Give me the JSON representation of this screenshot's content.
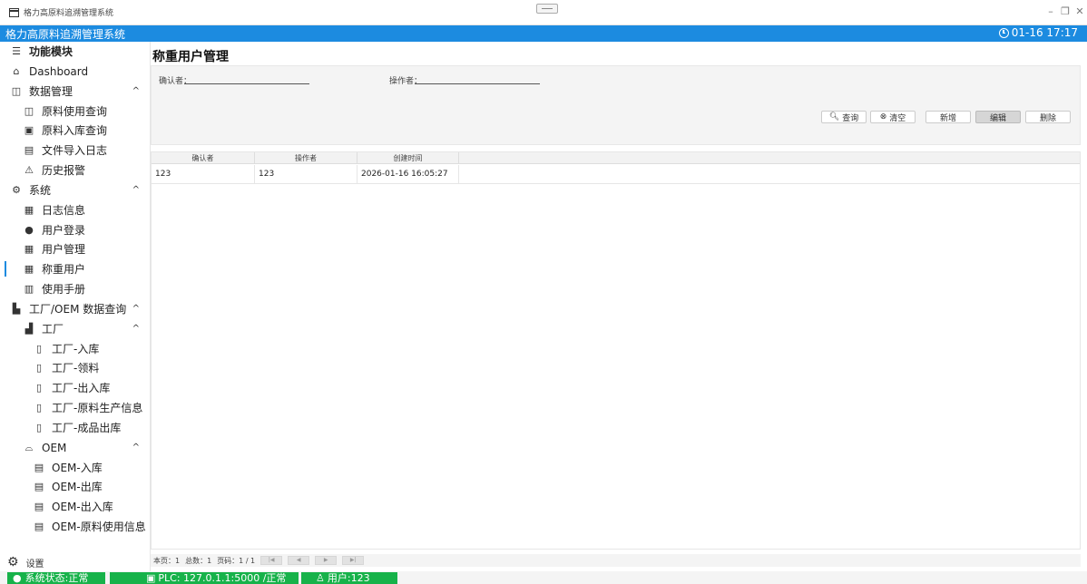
{
  "window": {
    "title": "格力高原料追溯管理系统",
    "controls": [
      "–",
      "❐",
      "✕"
    ]
  },
  "header": {
    "app_name": "格力高原料追溯管理系统",
    "datetime": "01-16 17:17"
  },
  "sidebar": {
    "items": [
      {
        "label": "功能模块",
        "icon": "menu-icon"
      },
      {
        "label": "Dashboard",
        "icon": "dashboard-icon"
      },
      {
        "label": "数据管理",
        "icon": "database-icon",
        "chevron": "^"
      },
      {
        "label": "原料使用查询",
        "icon": "database-icon"
      },
      {
        "label": "原料入库查询",
        "icon": "chart-icon"
      },
      {
        "label": "文件导入日志",
        "icon": "log-icon"
      },
      {
        "label": "历史报警",
        "icon": "alarm-icon"
      },
      {
        "label": "系统",
        "icon": "gear-icon",
        "chevron": "^"
      },
      {
        "label": "日志信息",
        "icon": "list-icon"
      },
      {
        "label": "用户登录",
        "icon": "user-icon"
      },
      {
        "label": "用户管理",
        "icon": "list-icon"
      },
      {
        "label": "称重用户",
        "icon": "list-icon"
      },
      {
        "label": "使用手册",
        "icon": "book-icon"
      },
      {
        "label": "工厂/OEM 数据查询",
        "icon": "factory-icon",
        "chevron": "^"
      },
      {
        "label": "工厂",
        "icon": "building-icon",
        "chevron": "^"
      },
      {
        "label": "工厂-入库",
        "icon": "clipboard-icon"
      },
      {
        "label": "工厂-领料",
        "icon": "clipboard-icon"
      },
      {
        "label": "工厂-出入库",
        "icon": "clipboard-icon"
      },
      {
        "label": "工厂-原料生产信息",
        "icon": "clipboard-icon"
      },
      {
        "label": "工厂-成品出库",
        "icon": "clipboard-icon"
      },
      {
        "label": "OEM",
        "icon": "cloud-icon",
        "chevron": "^"
      },
      {
        "label": "OEM-入库",
        "icon": "document-icon"
      },
      {
        "label": "OEM-出库",
        "icon": "document-icon"
      },
      {
        "label": "OEM-出入库",
        "icon": "document-icon"
      },
      {
        "label": "OEM-原料使用信息",
        "icon": "document-icon"
      }
    ],
    "settings_label": "设置"
  },
  "main": {
    "title": "称重用户管理",
    "filters": {
      "confirmer_label": "确认者：",
      "operator_label": "操作者："
    },
    "buttons": {
      "query": "查询",
      "clear": "清空",
      "add": "新增",
      "edit": "编辑",
      "delete": "删除"
    },
    "table": {
      "headers": [
        "确认者",
        "操作者",
        "创建时间"
      ],
      "rows": [
        [
          "123",
          "123",
          "2026-01-16 16:05:27"
        ]
      ]
    },
    "pager": {
      "this_page": "本页：1",
      "total": "总数：1",
      "page": "页码：1 / 1"
    }
  },
  "statusbar": {
    "system": "系统状态:正常",
    "plc": "PLC: 127.0.1.1:5000 /正常",
    "user": "用户:123"
  },
  "colors": {
    "accent": "#1c8be0",
    "status_green": "#17b24a"
  }
}
